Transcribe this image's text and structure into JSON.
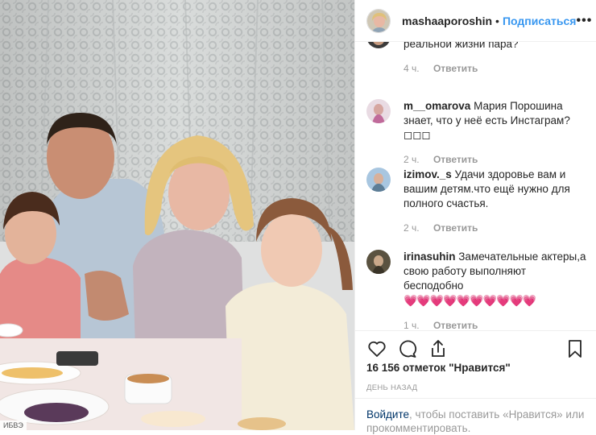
{
  "post": {
    "username": "mashaaporoshin",
    "separator": "•",
    "follow_label": "Подписаться",
    "more_label": "•••",
    "photo_tag": "ИБВЭ"
  },
  "comments": [
    {
      "user": "",
      "text": "реальной жизни пара?",
      "time": "4 ч.",
      "reply_label": "Ответить"
    },
    {
      "user": "m__omarova",
      "text": "Мария Порошина знает, что у неё есть Инстаграм? ◻◻◻",
      "time": "2 ч.",
      "reply_label": "Ответить"
    },
    {
      "user": "izimov._s",
      "text": "Удачи здоровье вам и вашим детям.что ещё нужно для полного счастья.",
      "time": "2 ч.",
      "reply_label": "Ответить"
    },
    {
      "user": "irinasuhin",
      "text": "Замечательные актеры,а свою работу выполняют бесподобно",
      "hearts": "💗💗💗💗💗💗💗💗💗💗",
      "time": "1 ч.",
      "reply_label": "Ответить"
    }
  ],
  "engagement": {
    "likes_text": "16 156 отметок \"Нравится\"",
    "timestamp": "ДЕНЬ НАЗАД"
  },
  "login_prompt": {
    "link": "Войдите",
    "text": ", чтобы поставить «Нравится» или прокомментировать."
  },
  "icons": [
    "heart-icon",
    "comment-icon",
    "share-icon",
    "bookmark-icon"
  ],
  "colors": {
    "accent": "#3897f0",
    "text": "#262626",
    "muted": "#999999",
    "link": "#003569"
  }
}
